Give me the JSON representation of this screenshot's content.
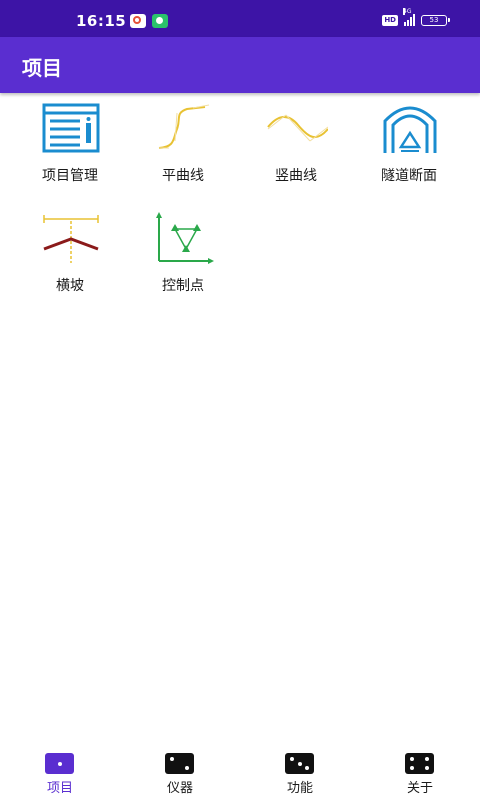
{
  "status_bar": {
    "time": "16:15",
    "network_type": "HD",
    "signal_label": "4G",
    "battery_level": "53"
  },
  "app_bar": {
    "title": "项目"
  },
  "tiles": [
    {
      "label": "项目管理",
      "icon": "project-manage-icon"
    },
    {
      "label": "平曲线",
      "icon": "horizontal-curve-icon"
    },
    {
      "label": "竖曲线",
      "icon": "vertical-curve-icon"
    },
    {
      "label": "隧道断面",
      "icon": "tunnel-section-icon"
    },
    {
      "label": "横坡",
      "icon": "cross-slope-icon"
    },
    {
      "label": "控制点",
      "icon": "control-point-icon"
    }
  ],
  "bottom_nav": {
    "items": [
      {
        "label": "项目",
        "icon": "dice-one-icon",
        "active": true
      },
      {
        "label": "仪器",
        "icon": "dice-two-icon",
        "active": false
      },
      {
        "label": "功能",
        "icon": "dice-three-icon",
        "active": false
      },
      {
        "label": "关于",
        "icon": "dice-four-icon",
        "active": false
      }
    ]
  },
  "colors": {
    "status_bar": "#3d14a6",
    "app_bar": "#5a2ed0",
    "accent": "#5a2ed0",
    "icon_blue": "#1a8ccf",
    "icon_yellow": "#e8c233",
    "icon_green": "#2aa84a",
    "icon_red": "#8b1a1a"
  }
}
